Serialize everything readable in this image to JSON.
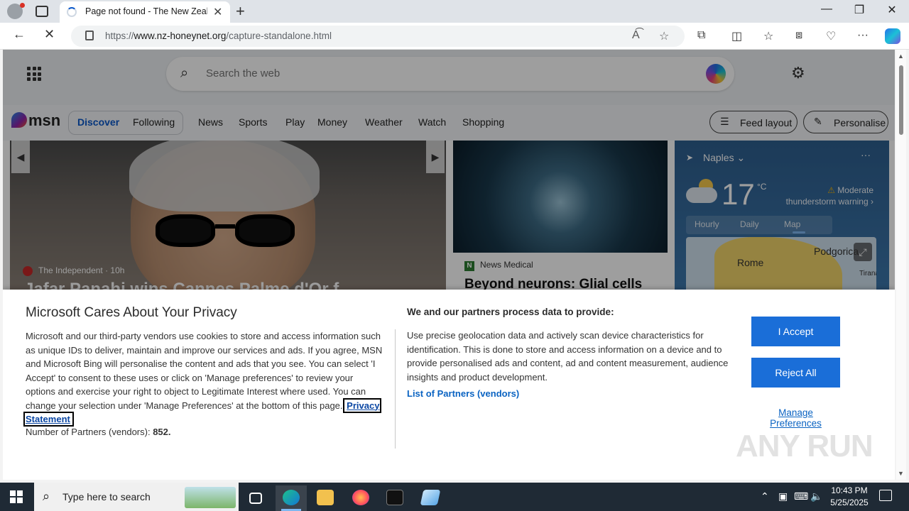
{
  "browser": {
    "tab_title": "Page not found - The New Zealand Honeynet",
    "url_prefix": "https://",
    "url_domain": "www.nz-honeynet.org",
    "url_path": "/capture-standalone.html"
  },
  "msn": {
    "search_placeholder": "Search the web",
    "logo_text": "msn",
    "pills": [
      "Discover",
      "Following"
    ],
    "nav": [
      "News",
      "Sports",
      "Play",
      "Money",
      "Weather",
      "Watch",
      "Shopping"
    ],
    "feed_layout": "Feed layout",
    "personalise": "Personalise"
  },
  "hero": {
    "source": "The Independent",
    "age": "10h",
    "title": "Jafar Panahi wins Cannes Palme d'Or f"
  },
  "card2": {
    "source": "News Medical",
    "source_initial": "N",
    "title": "Beyond neurons: Glial cells"
  },
  "weather": {
    "location": "Naples",
    "temp": "17",
    "unit": "°C",
    "warning": "Moderate thunderstorm warning",
    "tabs": [
      "Hourly",
      "Daily",
      "Map"
    ],
    "map_labels": [
      "Podgorica",
      "Rome",
      "Tirana"
    ]
  },
  "privacy": {
    "title": "Microsoft Cares About Your Privacy",
    "body": "Microsoft and our third-party vendors use cookies to store and access information such as unique IDs to deliver, maintain and improve our services and ads. If you agree, MSN and Microsoft Bing will personalise the content and ads that you see. You can select 'I Accept' to consent to these uses or click on 'Manage preferences' to review your options and exercise your right to object to Legitimate Interest where used.  You can change your selection under 'Manage Preferences' at the bottom of this page.",
    "link": "Privacy Statement",
    "count_label": "Number of Partners (vendors):",
    "count_value": "852.",
    "h2": "We and our partners process data to provide:",
    "body2": "Use precise geolocation data and actively scan device characteristics for identification. This is done to store and access information on a device and to provide personalised ads and content, ad and content measurement, audience insights and product development.",
    "vendors_link": "List of Partners (vendors)",
    "accept": "I Accept",
    "reject": "Reject All",
    "manage": "Manage Preferences"
  },
  "watermark": "ANY RUN",
  "taskbar": {
    "search_placeholder": "Type here to search",
    "time": "10:43 PM",
    "date": "5/25/2025"
  }
}
